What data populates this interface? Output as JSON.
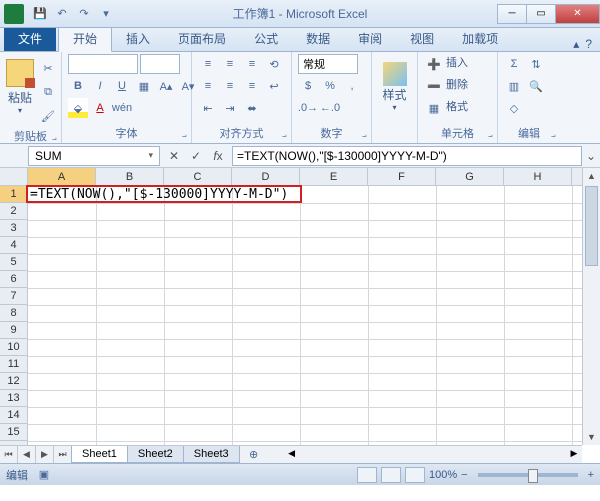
{
  "window": {
    "title": "工作簿1 - Microsoft Excel"
  },
  "tabs": {
    "file": "文件",
    "items": [
      "开始",
      "插入",
      "页面布局",
      "公式",
      "数据",
      "审阅",
      "视图",
      "加载项"
    ],
    "activeIndex": 0
  },
  "ribbon": {
    "clipboard": {
      "label": "剪贴板",
      "paste": "粘贴"
    },
    "font": {
      "label": "字体",
      "name": "",
      "size": ""
    },
    "alignment": {
      "label": "对齐方式",
      "wrap": ""
    },
    "number": {
      "label": "数字",
      "format": "常规"
    },
    "styles": {
      "label": "样式",
      "button": "样式"
    },
    "cells": {
      "label": "单元格",
      "insert": "插入",
      "delete": "删除",
      "format": "格式"
    },
    "editing": {
      "label": "编辑"
    }
  },
  "formula": {
    "namebox": "SUM",
    "bar": "=TEXT(NOW(),\"[$-130000]YYYY-M-D\")",
    "cell_edit": "=TEXT(NOW(),\"[$-130000]YYYY-M-D\")"
  },
  "grid": {
    "columns": [
      "A",
      "B",
      "C",
      "D",
      "E",
      "F",
      "G",
      "H"
    ],
    "rows": [
      "1",
      "2",
      "3",
      "4",
      "5",
      "6",
      "7",
      "8",
      "9",
      "10",
      "11",
      "12",
      "13",
      "14",
      "15"
    ]
  },
  "sheets": {
    "tabs": [
      "Sheet1",
      "Sheet2",
      "Sheet3"
    ],
    "activeIndex": 0
  },
  "status": {
    "mode": "编辑",
    "zoom": "100%",
    "minus": "−",
    "plus": "+"
  }
}
